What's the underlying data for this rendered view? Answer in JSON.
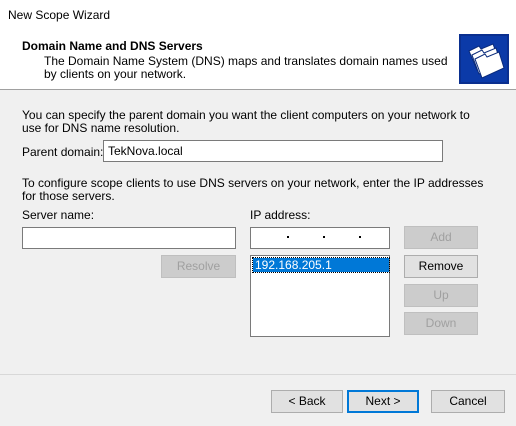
{
  "window": {
    "title": "New Scope Wizard"
  },
  "header": {
    "title": "Domain Name and DNS Servers",
    "description": "The Domain Name System (DNS) maps and translates domain names used by clients on your network.",
    "icon": "folder-stack-icon"
  },
  "main": {
    "intro": "You can specify the parent domain you want the client computers on your network to use for DNS name resolution.",
    "parent_domain_label": "Parent domain:",
    "parent_domain_value": "TekNova.local",
    "dns_intro": "To configure scope clients to use DNS servers on your network, enter the IP addresses for those servers.",
    "server_name_label": "Server name:",
    "server_name_value": "",
    "ip_address_label": "IP address:",
    "resolve_label": "Resolve",
    "add_label": "Add",
    "remove_label": "Remove",
    "up_label": "Up",
    "down_label": "Down",
    "ip_list": [
      "192.168.205.1"
    ]
  },
  "footer": {
    "back_label": "< Back",
    "next_label": "Next >",
    "cancel_label": "Cancel"
  }
}
